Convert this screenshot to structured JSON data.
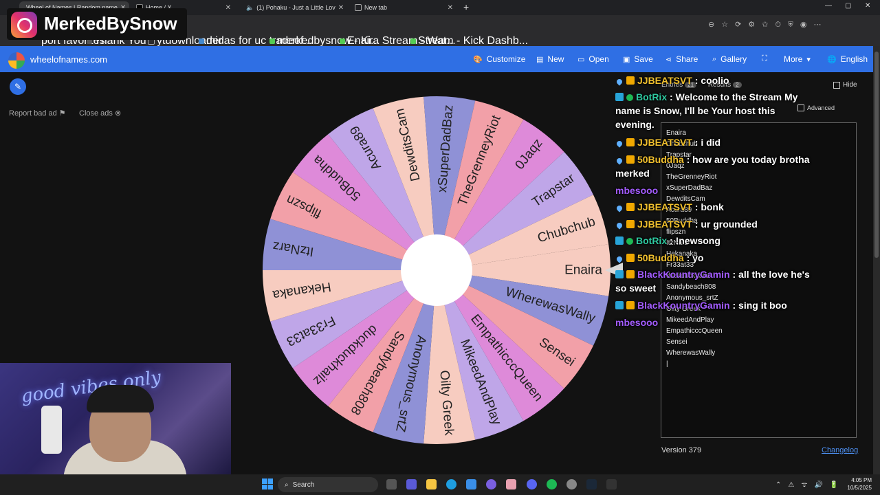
{
  "browser": {
    "tabs": [
      {
        "label": "Wheel of Names | Random name",
        "active": true
      },
      {
        "label": "Home / X"
      },
      {
        "label": "(1) Pohaku - Just a Little Lov"
      },
      {
        "label": "New tab"
      }
    ],
    "favorites": [
      "port favorites",
      "Thank You",
      "ytdownloader",
      "midas for uc tradeof...",
      "merkedbysnow - Ki...",
      "Enaira Stream - Wat...",
      "Stream - Kick Dashb..."
    ]
  },
  "app": {
    "brand": "wheelofnames.com",
    "menu": [
      "Customize",
      "New",
      "Open",
      "Save",
      "Share",
      "Gallery",
      "More",
      "English"
    ],
    "report_ad": "Report bad ad",
    "close_ads": "Close ads"
  },
  "wheel": {
    "slices": [
      "Enaira",
      "WherewasWally",
      "Sensei",
      "EmpathicccQueen",
      "MikeedAndPlay",
      "Oilty Greek",
      "Anonymous_srtZ",
      "Sandybeach808",
      "duckduckhailz",
      "Fr33at33",
      "Hekanaka",
      "ItzNarz",
      "flipszn",
      "50Buddha",
      "Acura89",
      "DewditsCam",
      "xSuperDadBaz",
      "TheGrenneyRiot",
      "0Jaqz",
      "Trapstar",
      "Chubchub"
    ],
    "colors": [
      "#f7ccc0",
      "#8f91d6",
      "#f2a0a8",
      "#de8ad9",
      "#bfa6e8"
    ]
  },
  "panel": {
    "entries_tab": "Entries",
    "entries_count": "21",
    "results_tab": "Results",
    "results_count": "2",
    "hide_label": "Hide",
    "advanced_label": "Advanced",
    "entries": [
      "Enaira",
      "Chubchub",
      "Trapstar",
      "0Jaqz",
      "TheGrenneyRiot",
      "xSuperDadBaz",
      "DewditsCam",
      "Acura89",
      "50Buddha",
      "flipszn",
      "ItzNarz",
      "Hekanaka",
      "Fr33at33",
      "duckduckhailz",
      "Sandybeach808",
      "Anonymous_srtZ",
      "Oilty Greek",
      "MikeedAndPlay",
      "EmpathicccQueen",
      "Sensei",
      "WherewasWally"
    ],
    "version": "Version 379",
    "changelog": "Changelog"
  },
  "chat": [
    {
      "user": "JJBEATSVT",
      "msg": "coolio",
      "color": "#f2c12e",
      "icons": [
        "drop",
        "crown"
      ]
    },
    {
      "user": "BotRix",
      "msg": "Welcome to the Stream My name is Snow, I'll be Your host this evening.",
      "color": "#2ec9a0",
      "icons": [
        "bot",
        "check"
      ]
    },
    {
      "user": "JJBEATSVT",
      "msg": "i did",
      "color": "#f2c12e",
      "icons": [
        "drop",
        "crown"
      ]
    },
    {
      "user": "50Buddha",
      "msg": "how are you today brotha merked",
      "color": "#f2c12e",
      "icons": [
        "drop",
        "crown"
      ]
    },
    {
      "user": "mbesooo",
      "msg": "",
      "color": "#a35cff",
      "icons": []
    },
    {
      "user": "JJBEATSVT",
      "msg": "bonk",
      "color": "#f2c12e",
      "icons": [
        "drop",
        "crown"
      ]
    },
    {
      "user": "JJBEATSVT",
      "msg": "ur grounded",
      "color": "#f2c12e",
      "icons": [
        "drop",
        "crown"
      ]
    },
    {
      "user": "BotRix",
      "msg": "!newsong",
      "color": "#2ec9a0",
      "icons": [
        "bot",
        "check"
      ]
    },
    {
      "user": "50Buddha",
      "msg": "yo",
      "color": "#f2c12e",
      "icons": [
        "drop",
        "crown"
      ]
    },
    {
      "user": "BlackKountryGamin",
      "msg": "all the love he's so sweet",
      "color": "#a35cff",
      "icons": [
        "bot",
        "crown"
      ]
    },
    {
      "user": "BlackKountryGamin",
      "msg": "sing it boo",
      "color": "#a35cff",
      "icons": [
        "bot",
        "crown"
      ]
    },
    {
      "user": "mbesooo",
      "msg": "",
      "color": "#a35cff",
      "icons": []
    }
  ],
  "overlay": {
    "instagram_handle": "MerkedBySnow",
    "neon_sign": "good vibes only"
  },
  "taskbar": {
    "search": "Search",
    "time": "4:05 PM",
    "date": "10/5/2025"
  }
}
